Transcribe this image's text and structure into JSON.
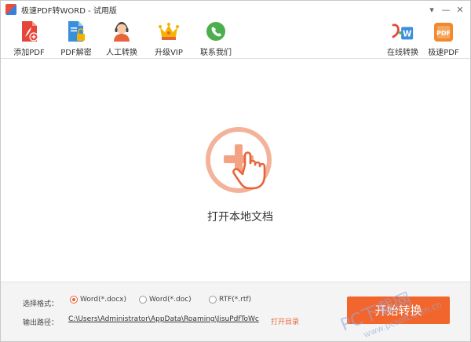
{
  "window": {
    "title": "极速PDF转WORD - 试用版",
    "controls": [
      "▾",
      "—",
      "✕"
    ]
  },
  "toolbar": {
    "left_items": [
      {
        "label": "添加PDF",
        "icon": "add-pdf-icon"
      },
      {
        "label": "PDF解密",
        "icon": "pdf-decrypt-icon"
      },
      {
        "label": "人工转换",
        "icon": "support-agent-icon"
      },
      {
        "label": "升级VIP",
        "icon": "crown-icon"
      },
      {
        "label": "联系我们",
        "icon": "phone-chat-icon"
      }
    ],
    "right_items": [
      {
        "label": "在线转换",
        "icon": "online-convert-icon"
      },
      {
        "label": "极速PDF",
        "icon": "jisu-pdf-icon"
      }
    ]
  },
  "main": {
    "open_local_label": "打开本地文档"
  },
  "bottom": {
    "format_label": "选择格式：",
    "formats": [
      {
        "label": "Word(*.docx)",
        "checked": true
      },
      {
        "label": "Word(*.doc)",
        "checked": false
      },
      {
        "label": "RTF(*.rtf)",
        "checked": false
      }
    ],
    "path_label": "输出路径：",
    "path_value": "C:\\Users\\Administrator\\AppData\\Roaming\\JisuPdfToWc",
    "open_dir_label": "打开目录",
    "start_label": "开始转换"
  },
  "watermark": {
    "text": "PC下载网",
    "url": "www.pcsoft.com.cn"
  },
  "colors": {
    "accent": "#f2662e",
    "accent_light": "#f3b39a"
  }
}
